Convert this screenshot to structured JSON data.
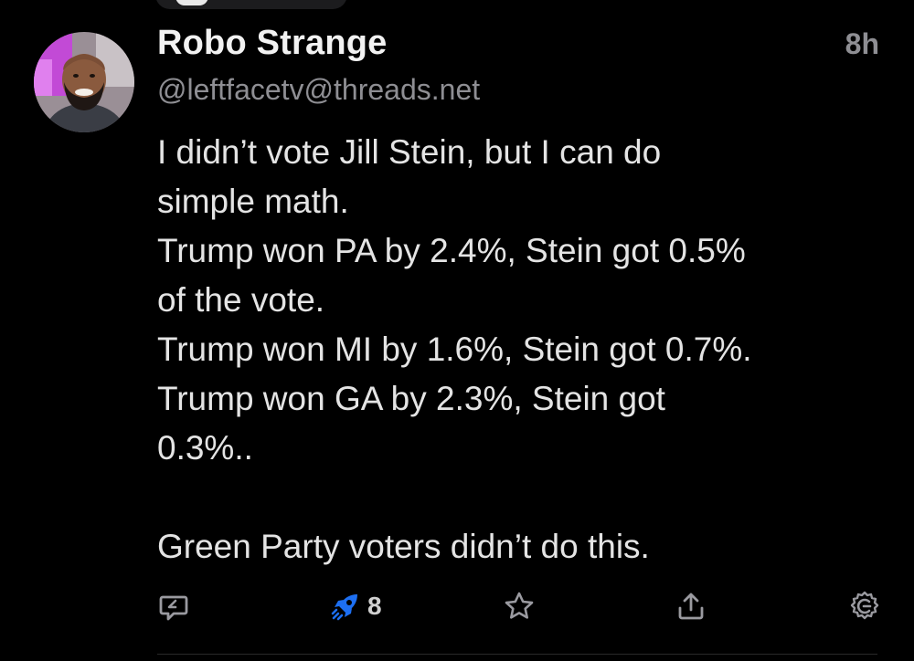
{
  "author": {
    "display_name": "Robo Strange",
    "handle": "@leftfacetv@threads.net",
    "timestamp": "8h"
  },
  "post": {
    "lines": [
      "I didn’t vote Jill Stein, but I can do",
      "simple math.",
      "Trump won PA by 2.4%, Stein got 0.5%",
      "of the vote.",
      "Trump won MI by 1.6%, Stein got 0.7%.",
      "Trump won GA by 2.3%, Stein got",
      "0.3%..",
      "",
      "Green Party voters didn’t do this."
    ]
  },
  "actions": {
    "reply_icon": "reply-bubble-icon",
    "boost_icon": "rocket-icon",
    "boost_count": "8",
    "boost_color": "#1d6ff2",
    "favorite_icon": "star-icon",
    "share_icon": "share-upload-icon",
    "more_icon": "gear-icon"
  },
  "colors": {
    "background": "#000000",
    "text_primary": "#f2f2f2",
    "text_secondary": "#8e8e93",
    "accent": "#1d6ff2"
  }
}
